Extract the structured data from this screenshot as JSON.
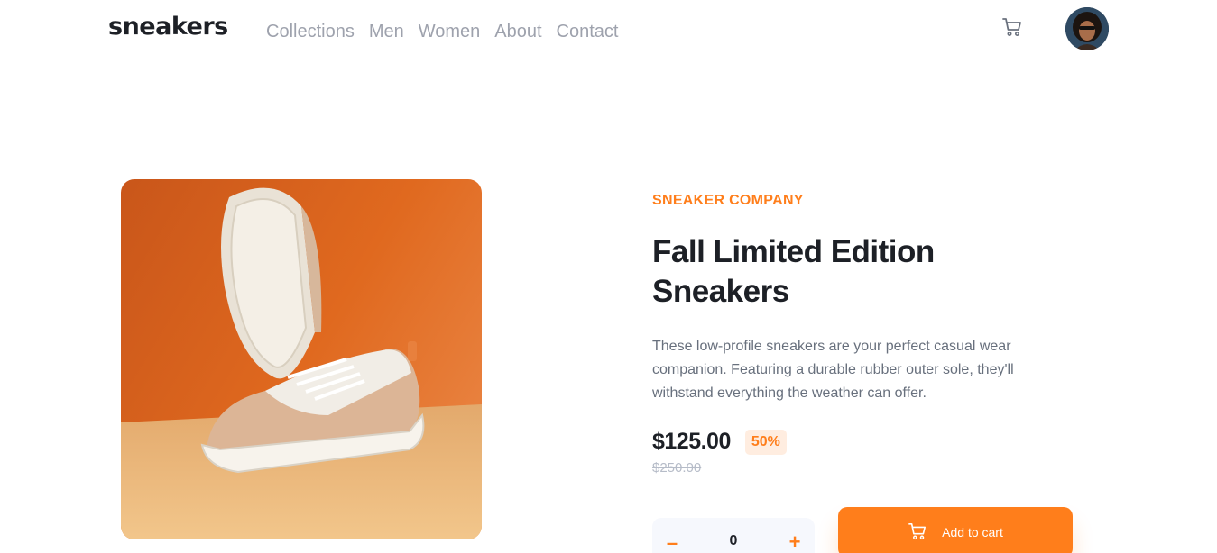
{
  "header": {
    "logo": "sneakers",
    "nav": [
      "Collections",
      "Men",
      "Women",
      "About",
      "Contact"
    ],
    "cart_icon": "cart-icon",
    "avatar_icon": "avatar"
  },
  "product": {
    "company": "SNEAKER COMPANY",
    "title_line1": "Fall Limited Edition",
    "title_line2": "Sneakers",
    "description": "These low-profile sneakers are your perfect casual wear companion. Featuring a durable rubber outer sole, they'll withstand everything the weather can offer.",
    "price": "$125.00",
    "discount": "50%",
    "old_price": "$250.00"
  },
  "cart_controls": {
    "minus": "–",
    "quantity": "0",
    "plus": "+",
    "add_label": "Add to cart"
  },
  "colors": {
    "accent": "#ff7e1b",
    "accent_pale": "#ffede0",
    "text_dark": "#1d2026",
    "text_grey": "#68707d",
    "nav_grey": "#9ea2ad"
  }
}
